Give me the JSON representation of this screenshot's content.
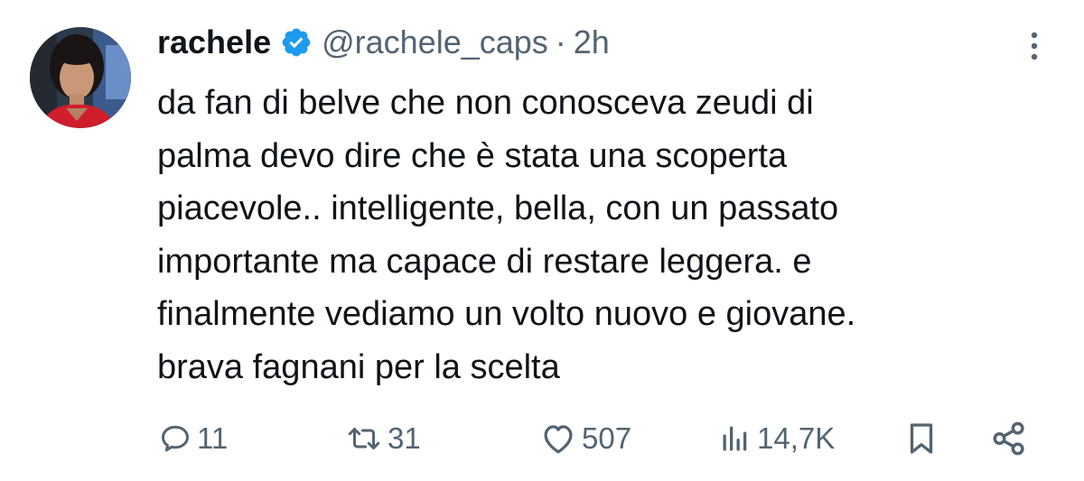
{
  "author": {
    "name": "rachele",
    "handle": "@rachele_caps",
    "separator": "·",
    "time": "2h",
    "verified": true
  },
  "text_lines": [
    "da fan di belve che non conosceva zeudi di",
    "palma devo dire che è stata una scoperta",
    "piacevole.. intelligente, bella, con un passato",
    "importante ma capace di restare leggera. e",
    "finalmente vediamo un volto nuovo e giovane.",
    "brava fagnani per la scelta"
  ],
  "actions": {
    "replies": "11",
    "reposts": "31",
    "likes": "507",
    "views": "14,7K"
  },
  "icons": {
    "verified": "verified-badge-icon",
    "more": "more-options-icon",
    "reply": "reply-icon",
    "repost": "repost-icon",
    "like": "heart-icon",
    "views": "views-icon",
    "bookmark": "bookmark-icon",
    "share": "share-icon"
  },
  "colors": {
    "text": "#0f1419",
    "secondary": "#536471",
    "verified": "#1d9bf0",
    "background": "#ffffff"
  }
}
